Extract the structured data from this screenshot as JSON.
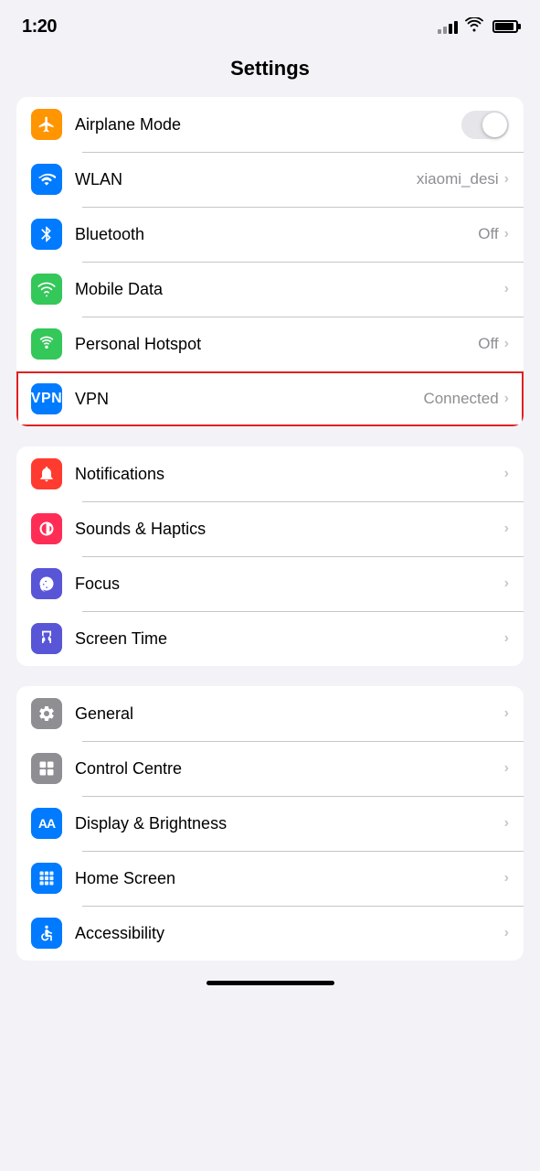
{
  "statusBar": {
    "time": "1:20"
  },
  "pageTitle": "Settings",
  "sections": [
    {
      "id": "connectivity",
      "items": [
        {
          "id": "airplane-mode",
          "label": "Airplane Mode",
          "iconBg": "bg-orange",
          "iconType": "airplane",
          "control": "toggle",
          "value": "",
          "highlighted": false
        },
        {
          "id": "wlan",
          "label": "WLAN",
          "iconBg": "bg-blue",
          "iconType": "wifi",
          "control": "chevron",
          "value": "xiaomi_desi",
          "highlighted": false
        },
        {
          "id": "bluetooth",
          "label": "Bluetooth",
          "iconBg": "bg-blue-dark",
          "iconType": "bluetooth",
          "control": "chevron",
          "value": "Off",
          "highlighted": false
        },
        {
          "id": "mobile-data",
          "label": "Mobile Data",
          "iconBg": "bg-green",
          "iconType": "signal",
          "control": "chevron",
          "value": "",
          "highlighted": false
        },
        {
          "id": "personal-hotspot",
          "label": "Personal Hotspot",
          "iconBg": "bg-green2",
          "iconType": "hotspot",
          "control": "chevron",
          "value": "Off",
          "highlighted": false
        },
        {
          "id": "vpn",
          "label": "VPN",
          "iconBg": "bg-blue2",
          "iconType": "vpn",
          "control": "chevron",
          "value": "Connected",
          "highlighted": true
        }
      ]
    },
    {
      "id": "notifications",
      "items": [
        {
          "id": "notifications",
          "label": "Notifications",
          "iconBg": "bg-red",
          "iconType": "bell",
          "control": "chevron",
          "value": "",
          "highlighted": false
        },
        {
          "id": "sounds-haptics",
          "label": "Sounds & Haptics",
          "iconBg": "bg-pink",
          "iconType": "sound",
          "control": "chevron",
          "value": "",
          "highlighted": false
        },
        {
          "id": "focus",
          "label": "Focus",
          "iconBg": "bg-purple",
          "iconType": "moon",
          "control": "chevron",
          "value": "",
          "highlighted": false
        },
        {
          "id": "screen-time",
          "label": "Screen Time",
          "iconBg": "bg-purple2",
          "iconType": "hourglass",
          "control": "chevron",
          "value": "",
          "highlighted": false
        }
      ]
    },
    {
      "id": "general",
      "items": [
        {
          "id": "general",
          "label": "General",
          "iconBg": "bg-gray",
          "iconType": "gear",
          "control": "chevron",
          "value": "",
          "highlighted": false
        },
        {
          "id": "control-centre",
          "label": "Control Centre",
          "iconBg": "bg-gray2",
          "iconType": "toggles",
          "control": "chevron",
          "value": "",
          "highlighted": false
        },
        {
          "id": "display-brightness",
          "label": "Display & Brightness",
          "iconBg": "bg-blue2",
          "iconType": "aa",
          "control": "chevron",
          "value": "",
          "highlighted": false
        },
        {
          "id": "home-screen",
          "label": "Home Screen",
          "iconBg": "bg-blue2",
          "iconType": "grid",
          "control": "chevron",
          "value": "",
          "highlighted": false
        },
        {
          "id": "accessibility",
          "label": "Accessibility",
          "iconBg": "bg-blue2",
          "iconType": "accessibility",
          "control": "chevron",
          "value": "",
          "highlighted": false
        }
      ]
    }
  ]
}
